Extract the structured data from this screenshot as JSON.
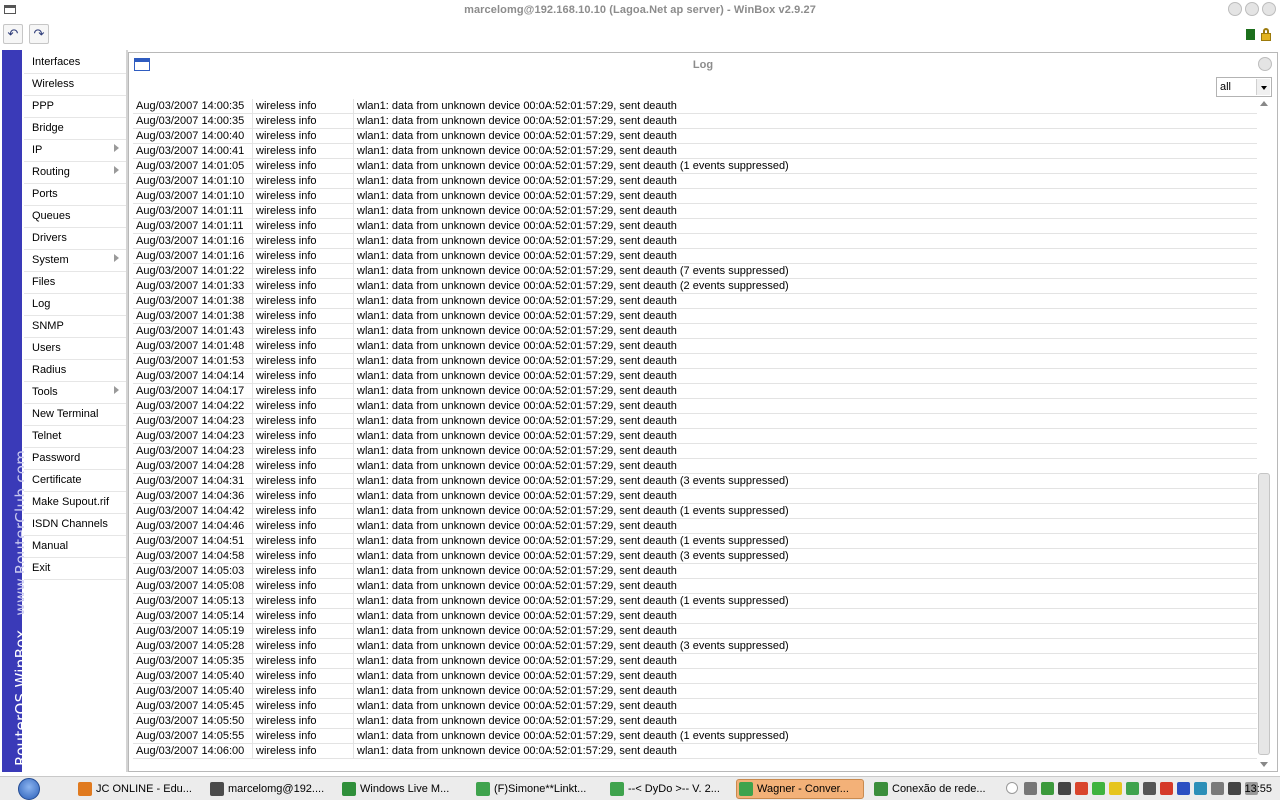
{
  "window": {
    "title": "marcelomg@192.168.10.10 (Lagoa.Net ap server) - WinBox v2.9.27"
  },
  "toolbar": {
    "undo_icon": "↶",
    "redo_icon": "↷"
  },
  "brand": {
    "main": "RouterOS WinBox",
    "site": "www.RouterClub.com"
  },
  "sidebar": {
    "items": [
      {
        "label": "Interfaces",
        "submenu": false
      },
      {
        "label": "Wireless",
        "submenu": false
      },
      {
        "label": "PPP",
        "submenu": false
      },
      {
        "label": "Bridge",
        "submenu": false
      },
      {
        "label": "IP",
        "submenu": true
      },
      {
        "label": "Routing",
        "submenu": true
      },
      {
        "label": "Ports",
        "submenu": false
      },
      {
        "label": "Queues",
        "submenu": false
      },
      {
        "label": "Drivers",
        "submenu": false
      },
      {
        "label": "System",
        "submenu": true
      },
      {
        "label": "Files",
        "submenu": false
      },
      {
        "label": "Log",
        "submenu": false
      },
      {
        "label": "SNMP",
        "submenu": false
      },
      {
        "label": "Users",
        "submenu": false
      },
      {
        "label": "Radius",
        "submenu": false
      },
      {
        "label": "Tools",
        "submenu": true
      },
      {
        "label": "New Terminal",
        "submenu": false
      },
      {
        "label": "Telnet",
        "submenu": false
      },
      {
        "label": "Password",
        "submenu": false
      },
      {
        "label": "Certificate",
        "submenu": false
      },
      {
        "label": "Make Supout.rif",
        "submenu": false
      },
      {
        "label": "ISDN Channels",
        "submenu": false
      },
      {
        "label": "Manual",
        "submenu": false
      },
      {
        "label": "Exit",
        "submenu": false
      }
    ]
  },
  "log": {
    "title": "Log",
    "filter_value": "all",
    "rows": [
      [
        "Aug/03/2007 14:00:35",
        "wireless info",
        "wlan1: data from unknown device 00:0A:52:01:57:29, sent deauth"
      ],
      [
        "Aug/03/2007 14:00:35",
        "wireless info",
        "wlan1: data from unknown device 00:0A:52:01:57:29, sent deauth"
      ],
      [
        "Aug/03/2007 14:00:40",
        "wireless info",
        "wlan1: data from unknown device 00:0A:52:01:57:29, sent deauth"
      ],
      [
        "Aug/03/2007 14:00:41",
        "wireless info",
        "wlan1: data from unknown device 00:0A:52:01:57:29, sent deauth"
      ],
      [
        "Aug/03/2007 14:01:05",
        "wireless info",
        "wlan1: data from unknown device 00:0A:52:01:57:29, sent deauth (1 events suppressed)"
      ],
      [
        "Aug/03/2007 14:01:10",
        "wireless info",
        "wlan1: data from unknown device 00:0A:52:01:57:29, sent deauth"
      ],
      [
        "Aug/03/2007 14:01:10",
        "wireless info",
        "wlan1: data from unknown device 00:0A:52:01:57:29, sent deauth"
      ],
      [
        "Aug/03/2007 14:01:11",
        "wireless info",
        "wlan1: data from unknown device 00:0A:52:01:57:29, sent deauth"
      ],
      [
        "Aug/03/2007 14:01:11",
        "wireless info",
        "wlan1: data from unknown device 00:0A:52:01:57:29, sent deauth"
      ],
      [
        "Aug/03/2007 14:01:16",
        "wireless info",
        "wlan1: data from unknown device 00:0A:52:01:57:29, sent deauth"
      ],
      [
        "Aug/03/2007 14:01:16",
        "wireless info",
        "wlan1: data from unknown device 00:0A:52:01:57:29, sent deauth"
      ],
      [
        "Aug/03/2007 14:01:22",
        "wireless info",
        "wlan1: data from unknown device 00:0A:52:01:57:29, sent deauth (7 events suppressed)"
      ],
      [
        "Aug/03/2007 14:01:33",
        "wireless info",
        "wlan1: data from unknown device 00:0A:52:01:57:29, sent deauth (2 events suppressed)"
      ],
      [
        "Aug/03/2007 14:01:38",
        "wireless info",
        "wlan1: data from unknown device 00:0A:52:01:57:29, sent deauth"
      ],
      [
        "Aug/03/2007 14:01:38",
        "wireless info",
        "wlan1: data from unknown device 00:0A:52:01:57:29, sent deauth"
      ],
      [
        "Aug/03/2007 14:01:43",
        "wireless info",
        "wlan1: data from unknown device 00:0A:52:01:57:29, sent deauth"
      ],
      [
        "Aug/03/2007 14:01:48",
        "wireless info",
        "wlan1: data from unknown device 00:0A:52:01:57:29, sent deauth"
      ],
      [
        "Aug/03/2007 14:01:53",
        "wireless info",
        "wlan1: data from unknown device 00:0A:52:01:57:29, sent deauth"
      ],
      [
        "Aug/03/2007 14:04:14",
        "wireless info",
        "wlan1: data from unknown device 00:0A:52:01:57:29, sent deauth"
      ],
      [
        "Aug/03/2007 14:04:17",
        "wireless info",
        "wlan1: data from unknown device 00:0A:52:01:57:29, sent deauth"
      ],
      [
        "Aug/03/2007 14:04:22",
        "wireless info",
        "wlan1: data from unknown device 00:0A:52:01:57:29, sent deauth"
      ],
      [
        "Aug/03/2007 14:04:23",
        "wireless info",
        "wlan1: data from unknown device 00:0A:52:01:57:29, sent deauth"
      ],
      [
        "Aug/03/2007 14:04:23",
        "wireless info",
        "wlan1: data from unknown device 00:0A:52:01:57:29, sent deauth"
      ],
      [
        "Aug/03/2007 14:04:23",
        "wireless info",
        "wlan1: data from unknown device 00:0A:52:01:57:29, sent deauth"
      ],
      [
        "Aug/03/2007 14:04:28",
        "wireless info",
        "wlan1: data from unknown device 00:0A:52:01:57:29, sent deauth"
      ],
      [
        "Aug/03/2007 14:04:31",
        "wireless info",
        "wlan1: data from unknown device 00:0A:52:01:57:29, sent deauth (3 events suppressed)"
      ],
      [
        "Aug/03/2007 14:04:36",
        "wireless info",
        "wlan1: data from unknown device 00:0A:52:01:57:29, sent deauth"
      ],
      [
        "Aug/03/2007 14:04:42",
        "wireless info",
        "wlan1: data from unknown device 00:0A:52:01:57:29, sent deauth (1 events suppressed)"
      ],
      [
        "Aug/03/2007 14:04:46",
        "wireless info",
        "wlan1: data from unknown device 00:0A:52:01:57:29, sent deauth"
      ],
      [
        "Aug/03/2007 14:04:51",
        "wireless info",
        "wlan1: data from unknown device 00:0A:52:01:57:29, sent deauth (1 events suppressed)"
      ],
      [
        "Aug/03/2007 14:04:58",
        "wireless info",
        "wlan1: data from unknown device 00:0A:52:01:57:29, sent deauth (3 events suppressed)"
      ],
      [
        "Aug/03/2007 14:05:03",
        "wireless info",
        "wlan1: data from unknown device 00:0A:52:01:57:29, sent deauth"
      ],
      [
        "Aug/03/2007 14:05:08",
        "wireless info",
        "wlan1: data from unknown device 00:0A:52:01:57:29, sent deauth"
      ],
      [
        "Aug/03/2007 14:05:13",
        "wireless info",
        "wlan1: data from unknown device 00:0A:52:01:57:29, sent deauth (1 events suppressed)"
      ],
      [
        "Aug/03/2007 14:05:14",
        "wireless info",
        "wlan1: data from unknown device 00:0A:52:01:57:29, sent deauth"
      ],
      [
        "Aug/03/2007 14:05:19",
        "wireless info",
        "wlan1: data from unknown device 00:0A:52:01:57:29, sent deauth"
      ],
      [
        "Aug/03/2007 14:05:28",
        "wireless info",
        "wlan1: data from unknown device 00:0A:52:01:57:29, sent deauth (3 events suppressed)"
      ],
      [
        "Aug/03/2007 14:05:35",
        "wireless info",
        "wlan1: data from unknown device 00:0A:52:01:57:29, sent deauth"
      ],
      [
        "Aug/03/2007 14:05:40",
        "wireless info",
        "wlan1: data from unknown device 00:0A:52:01:57:29, sent deauth"
      ],
      [
        "Aug/03/2007 14:05:40",
        "wireless info",
        "wlan1: data from unknown device 00:0A:52:01:57:29, sent deauth"
      ],
      [
        "Aug/03/2007 14:05:45",
        "wireless info",
        "wlan1: data from unknown device 00:0A:52:01:57:29, sent deauth"
      ],
      [
        "Aug/03/2007 14:05:50",
        "wireless info",
        "wlan1: data from unknown device 00:0A:52:01:57:29, sent deauth"
      ],
      [
        "Aug/03/2007 14:05:55",
        "wireless info",
        "wlan1: data from unknown device 00:0A:52:01:57:29, sent deauth (1 events suppressed)"
      ],
      [
        "Aug/03/2007 14:06:00",
        "wireless info",
        "wlan1: data from unknown device 00:0A:52:01:57:29, sent deauth"
      ]
    ]
  },
  "taskbar": {
    "tasks": [
      {
        "label": "JC ONLINE - Edu...",
        "icon": "firefox-icon",
        "color": "#e07a1f",
        "active": false
      },
      {
        "label": "marcelomg@192....",
        "icon": "winbox-icon",
        "color": "#4b4b4b",
        "active": false
      },
      {
        "label": "Windows Live M...",
        "icon": "messenger-icon",
        "color": "#2f8f3a",
        "active": false
      },
      {
        "label": "(F)Simone**Linkt...",
        "icon": "msn-buddy-icon",
        "color": "#3fa34d",
        "active": false
      },
      {
        "label": "--< DyDo >-- V. 2...",
        "icon": "msn-buddy-icon",
        "color": "#3fa34d",
        "active": false
      },
      {
        "label": "Wagner - Conver...",
        "icon": "msn-buddy-icon",
        "color": "#3fa34d",
        "active": true
      },
      {
        "label": "Conexão de rede...",
        "icon": "network-icon",
        "color": "#3b8e3b",
        "active": false
      }
    ],
    "tray_icons": [
      {
        "name": "tray-gear-icon",
        "color": "#777777"
      },
      {
        "name": "tray-user-icon",
        "color": "#3c9a3c"
      },
      {
        "name": "tray-monitor-icon",
        "color": "#444444"
      },
      {
        "name": "tray-flower-icon",
        "color": "#d9452c"
      },
      {
        "name": "tray-check-icon",
        "color": "#3fb33f"
      },
      {
        "name": "tray-smiley-icon",
        "color": "#e6c51e"
      },
      {
        "name": "tray-messenger-icon",
        "color": "#3fa34d"
      },
      {
        "name": "tray-phone-icon",
        "color": "#555555"
      },
      {
        "name": "tray-wifi-icon",
        "color": "#d53a2a"
      },
      {
        "name": "tray-bluetooth-icon",
        "color": "#2b4fc2"
      },
      {
        "name": "tray-shield-icon",
        "color": "#2c8fb8"
      },
      {
        "name": "tray-drive-icon",
        "color": "#7a7a7a"
      },
      {
        "name": "tray-volume-icon",
        "color": "#444444"
      },
      {
        "name": "tray-eye-icon",
        "color": "#999999"
      }
    ],
    "clock": "13:55"
  }
}
